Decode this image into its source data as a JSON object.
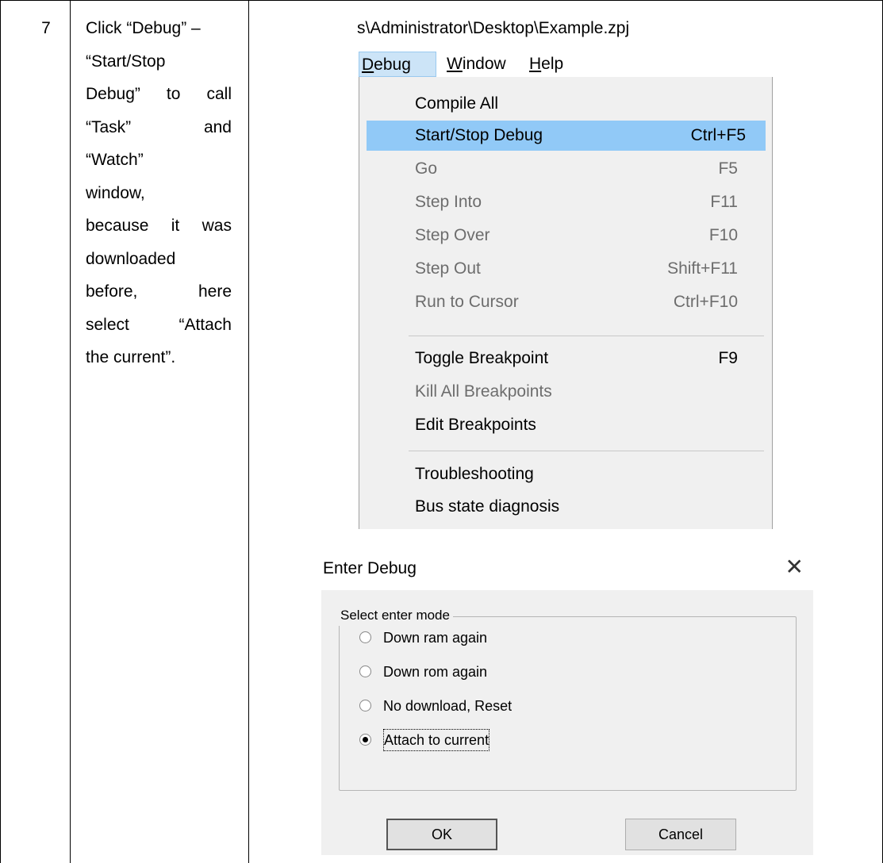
{
  "step": {
    "number": "7"
  },
  "instruction": {
    "lines": [
      "Click “Debug” –",
      "“Start/Stop",
      "Debug” to call",
      "“Task” and",
      "“Watch”",
      "window,",
      "because it was",
      "downloaded",
      "before, here",
      "select “Attach",
      "the current”."
    ]
  },
  "window": {
    "title": "s\\Administrator\\Desktop\\Example.zpj"
  },
  "menubar": {
    "items": [
      {
        "label": "Debug",
        "mnemonic": "D",
        "rest": "ebug",
        "active": true
      },
      {
        "label": "Window",
        "mnemonic": "W",
        "rest": "indow",
        "active": false
      },
      {
        "label": "Help",
        "mnemonic": "H",
        "rest": "elp",
        "active": false
      }
    ]
  },
  "debug_menu": {
    "items": [
      {
        "label": "Compile All",
        "shortcut": "",
        "state": "enabled"
      },
      {
        "label": "Start/Stop Debug",
        "shortcut": "Ctrl+F5",
        "state": "highlighted"
      },
      {
        "label": "Go",
        "shortcut": "F5",
        "state": "disabled"
      },
      {
        "label": "Step Into",
        "shortcut": "F11",
        "state": "disabled"
      },
      {
        "label": "Step Over",
        "shortcut": "F10",
        "state": "disabled"
      },
      {
        "label": "Step Out",
        "shortcut": "Shift+F11",
        "state": "disabled"
      },
      {
        "label": "Run to Cursor",
        "shortcut": "Ctrl+F10",
        "state": "disabled"
      },
      {
        "label": "Toggle Breakpoint",
        "shortcut": "F9",
        "state": "enabled"
      },
      {
        "label": "Kill All Breakpoints",
        "shortcut": "",
        "state": "disabled"
      },
      {
        "label": "Edit Breakpoints",
        "shortcut": "",
        "state": "enabled"
      },
      {
        "label": "Troubleshooting",
        "shortcut": "",
        "state": "enabled"
      },
      {
        "label": "Bus state diagnosis",
        "shortcut": "",
        "state": "enabled"
      }
    ]
  },
  "dialog": {
    "title": "Enter Debug",
    "close_glyph": "✕",
    "group_label": "Select enter mode",
    "options": [
      {
        "label": "Down ram again",
        "checked": false
      },
      {
        "label": "Down rom again",
        "checked": false
      },
      {
        "label": "No download, Reset",
        "checked": false
      },
      {
        "label": "Attach to current",
        "checked": true
      }
    ],
    "ok_label": "OK",
    "cancel_label": "Cancel"
  },
  "colors": {
    "menu_highlight": "#91c9f7",
    "menu_background": "#f0f0f0",
    "disabled_text": "#6d6d6d",
    "dialog_background": "#f0f0f0"
  }
}
